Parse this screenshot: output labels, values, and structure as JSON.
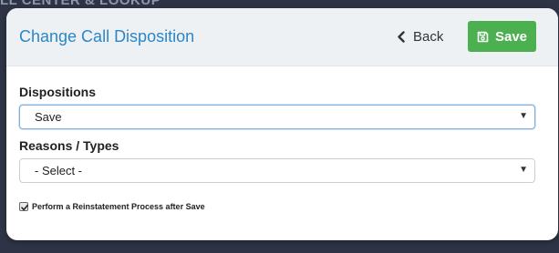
{
  "background": {
    "header_text": "LL CENTER & LOOKUP"
  },
  "modal": {
    "title": "Change Call Disposition",
    "back_label": "Back",
    "save_label": "Save"
  },
  "form": {
    "dispositions": {
      "label": "Dispositions",
      "selected": "Save"
    },
    "reasons": {
      "label": "Reasons / Types",
      "selected": "- Select -"
    },
    "reinstatement": {
      "label": "Perform a Reinstatement Process after Save",
      "checked": true
    }
  },
  "colors": {
    "title": "#2b86c8",
    "save_button": "#4caf50",
    "header_bg": "#eef1f4",
    "backdrop": "#2e3446"
  },
  "icons": {
    "back": "chevron-left-icon",
    "save": "floppy-disk-icon",
    "select_arrow": "caret-down-icon",
    "check": "checkmark-icon"
  }
}
